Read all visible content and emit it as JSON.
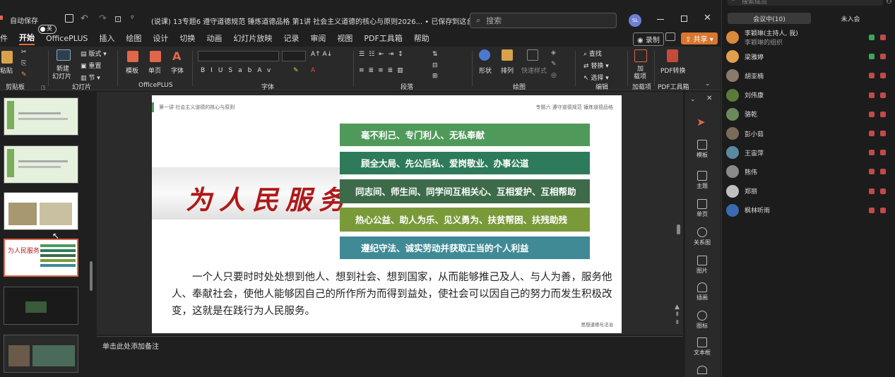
{
  "titlebar": {
    "autosave_label": "自动保存",
    "autosave_state": "关",
    "doc_title": "(说课) 13专题6 遵守道德规范 锤炼道德品格 第1讲 社会主义道德的核心与原则2026...  •  已保存到这台电脑",
    "search_placeholder": "搜索",
    "user_initials": "SL"
  },
  "menu": {
    "items": [
      "件",
      "开始",
      "OfficePLUS",
      "插入",
      "绘图",
      "设计",
      "切换",
      "动画",
      "幻灯片放映",
      "记录",
      "审阅",
      "视图",
      "PDF工具箱",
      "帮助"
    ],
    "record": "录制",
    "share": "共享"
  },
  "ribbon": {
    "paste": "粘贴",
    "clipboard": "剪贴板",
    "new_slide_1": "新建",
    "new_slide_2": "幻灯片",
    "layout": "版式",
    "reset": "重置",
    "section": "节",
    "slides": "幻灯片",
    "template": "模板",
    "single_page": "单页",
    "font_btn": "字体",
    "officeplus": "OfficePLUS",
    "font": "字体",
    "paragraph": "段落",
    "shape": "形状",
    "arrange": "排列",
    "quick_style": "快速样式",
    "drawing": "绘图",
    "find": "查找",
    "replace": "替换",
    "select": "选择",
    "editing": "编辑",
    "addins_1": "加",
    "addins_2": "载项",
    "addins": "加载项",
    "pdf_convert": "PDF转换",
    "pdf_toolbox": "PDF工具箱"
  },
  "slide": {
    "header_left": "第一讲  社会主义道德的核心与原则",
    "header_right": "专题六  遵守道德规范  锤炼道德品格",
    "calligraphy": "为人民服务",
    "bars": [
      {
        "text": "毫不利己、专门利人、无私奉献",
        "color": "#4f9a5a"
      },
      {
        "text": "顾全大局、先公后私、爱岗敬业、办事公道",
        "color": "#2e7b5b"
      },
      {
        "text": "同志间、师生间、同学间互相关心、互相爱护、互相帮助",
        "color": "#3d6b4a"
      },
      {
        "text": "热心公益、助人为乐、见义勇为、扶贫帮困、扶残助残",
        "color": "#7a9a3a"
      },
      {
        "text": "遵纪守法、诚实劳动并获取正当的个人利益",
        "color": "#3f8a95"
      }
    ],
    "body": "一个人只要时时处处想到他人、想到社会、想到国家，从而能够推己及人、与人为善，服务他人、奉献社会，使他人能够因自己的所作所为而得到益处，使社会可以因自己的努力而发生积极改变，这就是在践行为人民服务。",
    "footer": "思想道德与法治"
  },
  "notes": {
    "placeholder": "单击此处添加备注"
  },
  "designer": {
    "items": [
      "模板",
      "主题",
      "单页",
      "关系图",
      "图片",
      "插画",
      "图标",
      "文本框"
    ]
  },
  "meeting": {
    "search_placeholder": "搜索成员",
    "tab_in": "会议中(10)",
    "tab_out": "未入会",
    "members": [
      {
        "name": "李颖琳(主持人, 我)",
        "sub": "李颖琳的组织",
        "color": "#d98a3a"
      },
      {
        "name": "梁雅婷",
        "sub": "",
        "color": "#e0a050"
      },
      {
        "name": "胡亚楠",
        "sub": "",
        "color": "#8a7a6a"
      },
      {
        "name": "刘伟康",
        "sub": "",
        "color": "#5a7a3a"
      },
      {
        "name": "骆乾",
        "sub": "",
        "color": "#6a8a5a"
      },
      {
        "name": "彭小茹",
        "sub": "",
        "color": "#7a6a5a"
      },
      {
        "name": "王宙萍",
        "sub": "",
        "color": "#5a8aa0"
      },
      {
        "name": "熊伟",
        "sub": "",
        "color": "#8a8a8a"
      },
      {
        "name": "郑丽",
        "sub": "",
        "color": "#c0c0c0"
      },
      {
        "name": "枫林听雨",
        "sub": "",
        "color": "#3a6ab0"
      }
    ]
  }
}
